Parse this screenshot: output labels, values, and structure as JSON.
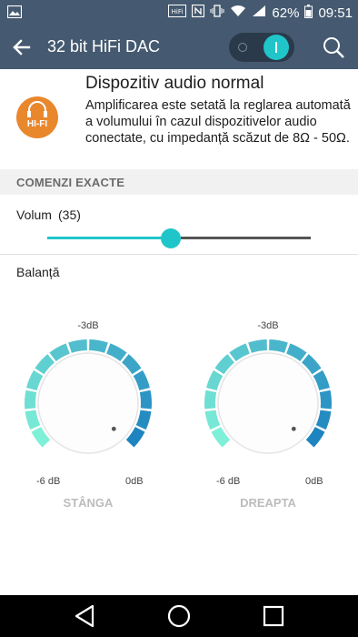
{
  "status_bar": {
    "icons": [
      "gallery-notification-icon",
      "hifi-icon",
      "nfc-icon",
      "vibrate-icon",
      "wifi-icon",
      "signal-icon",
      "battery-icon"
    ],
    "hifi_badge": "HiFi",
    "battery_percent": "62%",
    "time": "09:51"
  },
  "app_bar": {
    "title": "32 bit HiFi DAC",
    "toggle_on": true,
    "icons": [
      "back-arrow-icon",
      "search-icon"
    ]
  },
  "info": {
    "badge_label": "HI-FI",
    "title": "Dispozitiv audio normal",
    "description": "Amplificarea este setată la reglarea automată a volumului în cazul dispozitivelor audio conectate, cu impedanță scăzut de 8Ω - 50Ω."
  },
  "section": {
    "header": "COMENZI EXACTE"
  },
  "volume": {
    "label": "Volum",
    "value": "(35)",
    "level": 0.47
  },
  "balance": {
    "label": "Balanță",
    "dials": [
      {
        "channel": "STÂNGA",
        "top_label": "-3dB",
        "min_label": "-6 dB",
        "max_label": "0dB"
      },
      {
        "channel": "DREAPTA",
        "top_label": "-3dB",
        "min_label": "-6 dB",
        "max_label": "0dB"
      }
    ]
  },
  "colors": {
    "bar": "#455a70",
    "accent": "#20c5c9",
    "badge": "#e9872d",
    "dial_start": "#7ef0d8",
    "dial_end": "#1e84c0"
  },
  "nav_bar": {
    "icons": [
      "nav-back-icon",
      "nav-home-icon",
      "nav-recents-icon"
    ]
  }
}
